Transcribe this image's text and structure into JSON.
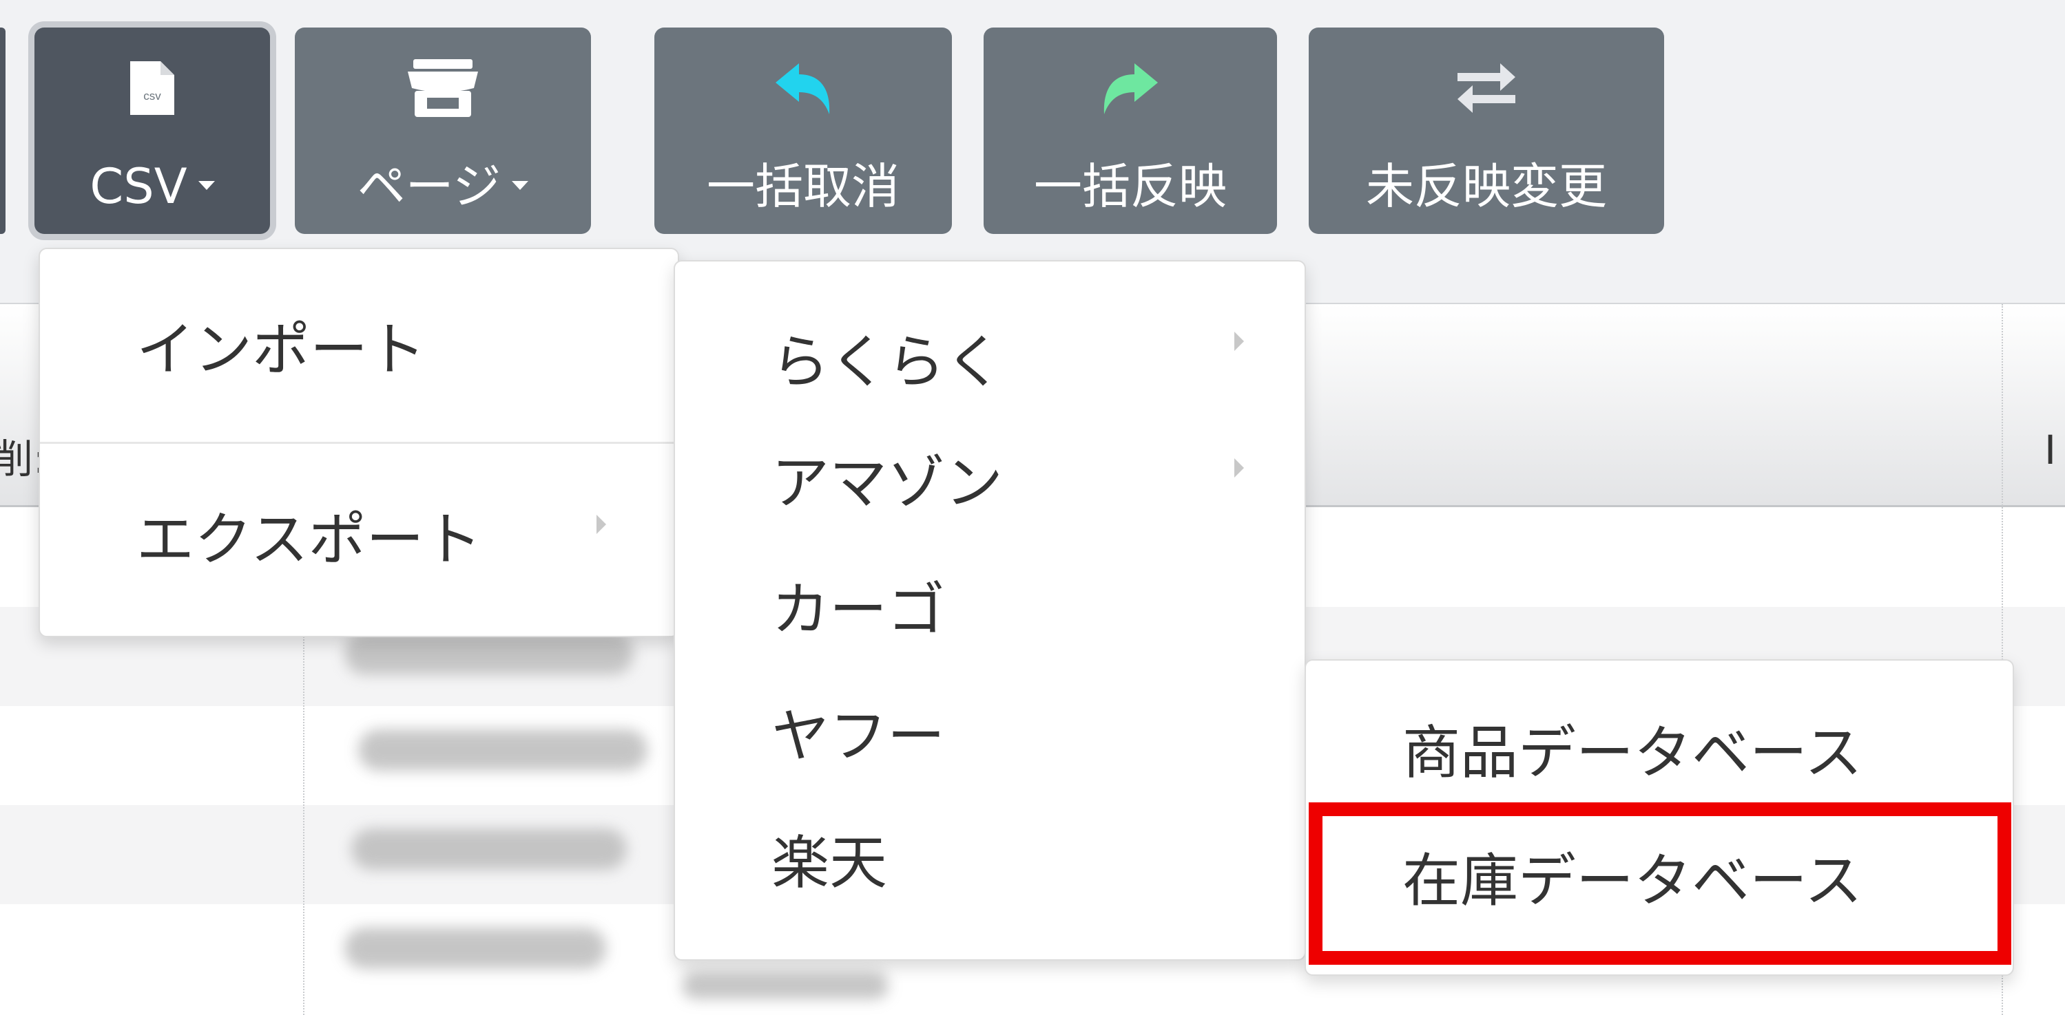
{
  "toolbar": {
    "buttons": [
      {
        "label": "CSV",
        "icon": "csv-file-icon",
        "dropdown": true,
        "active": true
      },
      {
        "label": "ページ",
        "icon": "store-icon",
        "dropdown": true
      },
      {
        "label": "一括取消",
        "icon": "undo-arrow-icon",
        "icon_color": "#22d3ee"
      },
      {
        "label": "一括反映",
        "icon": "redo-arrow-icon",
        "icon_color": "#6ee7a0"
      },
      {
        "label": "未反映変更",
        "icon": "exchange-arrows-icon",
        "icon_color": "#e5e7eb"
      }
    ],
    "csv_icon_text": "csv"
  },
  "csv_menu": {
    "items": [
      {
        "label": "インポート",
        "has_submenu": false
      },
      {
        "label": "エクスポート",
        "has_submenu": true
      }
    ]
  },
  "export_menu": {
    "items": [
      {
        "label": "らくらく",
        "has_submenu": true
      },
      {
        "label": "アマゾン",
        "has_submenu": true
      },
      {
        "label": "カーゴ",
        "has_submenu": false
      },
      {
        "label": "ヤフー",
        "has_submenu": false
      },
      {
        "label": "楽天",
        "has_submenu": false
      }
    ]
  },
  "database_menu": {
    "items": [
      {
        "label": "商品データベース",
        "highlighted": false
      },
      {
        "label": "在庫データベース",
        "highlighted": true
      }
    ],
    "highlight_color": "#ee0000"
  },
  "table": {
    "header_fragments": [
      "削:",
      "I"
    ]
  },
  "colors": {
    "button_bg": "#6c757d",
    "button_active_bg": "#4f5660",
    "page_bg": "#f1f2f4"
  }
}
